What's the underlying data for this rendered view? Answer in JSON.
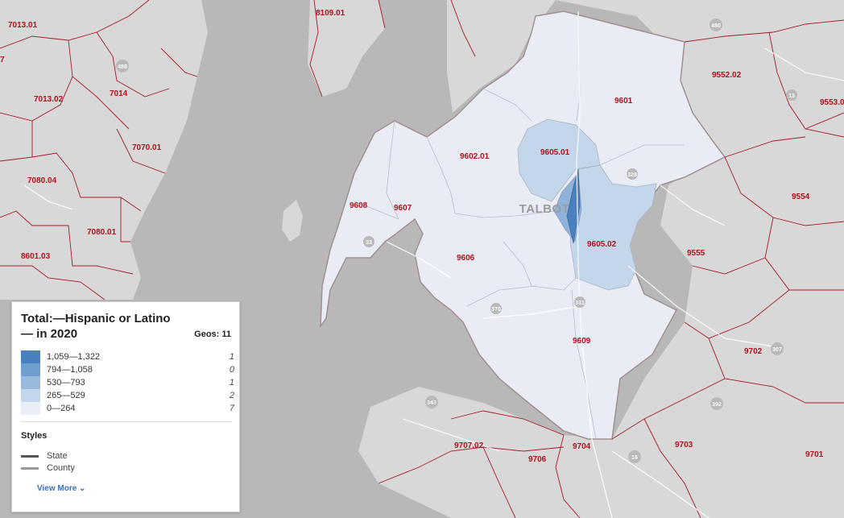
{
  "county": {
    "name": "TALBOT"
  },
  "tracts": {
    "t7013_01": "7013.01",
    "t7013_02": "7013.02",
    "t7014": "7014",
    "t7070_01": "7070.01",
    "t7080_04": "7080.04",
    "t7080_01": "7080.01",
    "t8601_03": "8601.03",
    "t7_edge": "7",
    "t8109_01": "8109.01",
    "t9552_02": "9552.02",
    "t9553_0": "9553.0",
    "t9601": "9601",
    "t9602_01": "9602.01",
    "t9605_01": "9605.01",
    "t9608": "9608",
    "t9607": "9607",
    "t9554": "9554",
    "t9605_02": "9605.02",
    "t9606": "9606",
    "t9555": "9555",
    "t9609": "9609",
    "t9702": "9702",
    "t9707_02": "9707.02",
    "t9704": "9704",
    "t9703": "9703",
    "t9706": "9706",
    "t9701": "9701"
  },
  "shields": [
    "480",
    "488",
    "307",
    "343",
    "392",
    "16",
    "33",
    "370",
    "328",
    "331",
    "13"
  ],
  "legend": {
    "title": "Total:—Hispanic or Latino— in 2020",
    "geos": "Geos: 11",
    "rows": [
      {
        "range": "1,059—1,322",
        "count": "1",
        "color": "#4a80bd"
      },
      {
        "range": "794—1,058",
        "count": "0",
        "color": "#6f9dcc"
      },
      {
        "range": "530—793",
        "count": "1",
        "color": "#97b9dc"
      },
      {
        "range": "265—529",
        "count": "2",
        "color": "#c3d6ea"
      },
      {
        "range": "0—264",
        "count": "7",
        "color": "#eaeef7"
      }
    ],
    "styles_title": "Styles",
    "styles": [
      {
        "label": "State",
        "color": "#555555"
      },
      {
        "label": "County",
        "color": "#9a9a9a"
      }
    ],
    "view_more": "View More ⌄"
  },
  "colors": {
    "land": "#d9d9d9",
    "water": "#b5b5b5",
    "tract_border": "#a8182a",
    "choropleth_lowest": "#eaeef7"
  }
}
